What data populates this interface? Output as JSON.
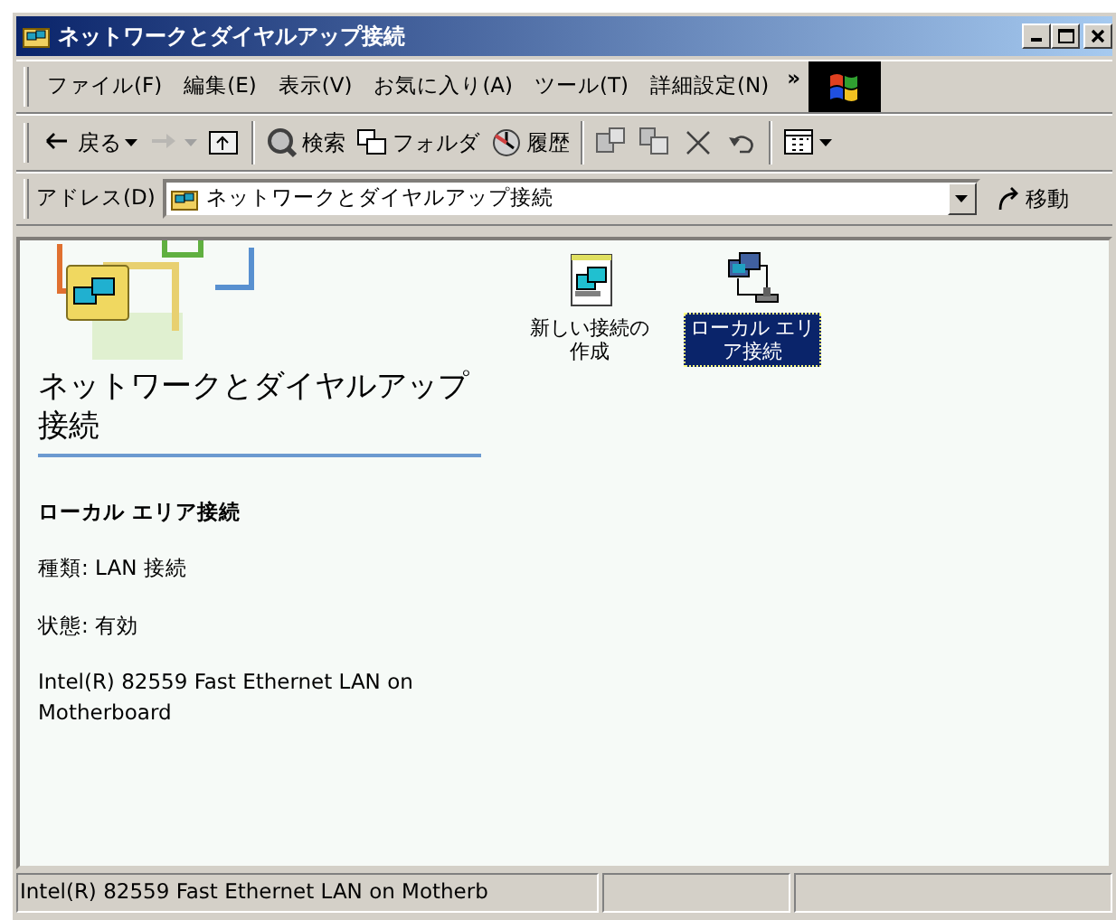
{
  "window": {
    "title": "ネットワークとダイヤルアップ接続"
  },
  "menu": {
    "items": [
      {
        "label": "ファイル(F)"
      },
      {
        "label": "編集(E)"
      },
      {
        "label": "表示(V)"
      },
      {
        "label": "お気に入り(A)"
      },
      {
        "label": "ツール(T)"
      },
      {
        "label": "詳細設定(N)"
      }
    ],
    "more": "»"
  },
  "toolbar": {
    "groups": [
      {
        "buttons": [
          {
            "kind": "back",
            "label": "戻る",
            "dropdown": true,
            "disabled": false
          },
          {
            "kind": "forward",
            "dropdown": true,
            "disabled": true
          },
          {
            "kind": "up",
            "dropdown": false,
            "disabled": false
          }
        ]
      },
      {
        "buttons": [
          {
            "kind": "search",
            "label": "検索",
            "disabled": false
          },
          {
            "kind": "folders",
            "label": "フォルダ",
            "disabled": false
          },
          {
            "kind": "history",
            "label": "履歴",
            "disabled": false
          }
        ]
      },
      {
        "buttons": [
          {
            "kind": "move",
            "disabled": false
          },
          {
            "kind": "copy",
            "disabled": false
          },
          {
            "kind": "delete",
            "disabled": false
          },
          {
            "kind": "undo",
            "disabled": false
          }
        ]
      },
      {
        "buttons": [
          {
            "kind": "views",
            "dropdown": true,
            "disabled": false
          }
        ]
      }
    ]
  },
  "address": {
    "label": "アドレス(D)",
    "value": "ネットワークとダイヤルアップ接続",
    "go": "移動"
  },
  "left_pane": {
    "title": "ネットワークとダイヤルアップ接続",
    "item_name": "ローカル エリア接続",
    "details": [
      "種類: LAN 接続",
      "状態: 有効",
      "Intel(R) 82559 Fast Ethernet LAN on Motherboard"
    ]
  },
  "icons": [
    {
      "kind": "wizard",
      "label": "新しい接続の作成",
      "selected": false
    },
    {
      "kind": "lan",
      "label": "ローカル エリア接続",
      "selected": true
    }
  ],
  "status_bar": {
    "text": "Intel(R) 82559 Fast Ethernet LAN on Motherb"
  }
}
